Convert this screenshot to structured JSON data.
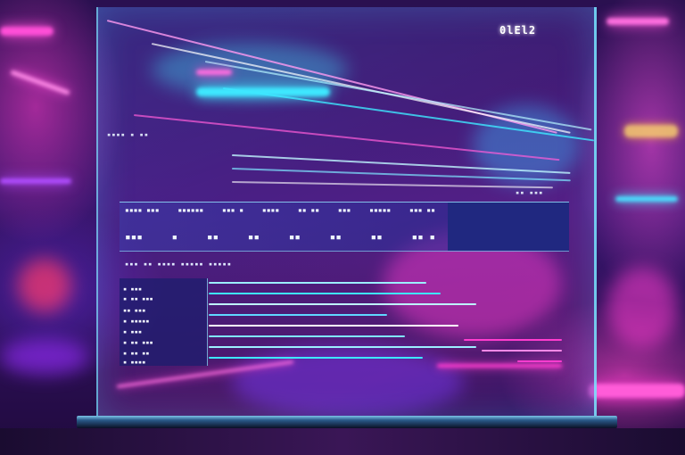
{
  "screen": {
    "header_tag": "0lEl2",
    "top_label": "▪▪▪▪ ▪ ▪▪",
    "top_right_label": "▪▪ ▪▪▪"
  },
  "table": {
    "header_cells": [
      "▪▪▪▪ ▪▪▪",
      "▪▪▪▪▪▪",
      "▪▪▪ ▪",
      "▪▪▪▪",
      "▪▪ ▪▪",
      "▪▪▪",
      "▪▪▪▪▪",
      "▪▪▪ ▪▪"
    ],
    "row_cells": [
      "▪▪▪",
      "▪",
      "▪▪",
      "▪▪",
      "▪▪",
      "▪▪",
      "▪▪",
      "▪▪ ▪"
    ]
  },
  "list": {
    "title": "▪▪▪ ▪▪ ▪▪▪▪ ▪▪▪▪▪ ▪▪▪▪▪",
    "items": [
      "▪ ▪▪▪",
      "▪ ▪▪ ▪▪▪",
      "▪▪ ▪▪▪",
      "▪ ▪▪▪▪▪",
      "▪ ▪▪▪",
      "▪ ▪▪ ▪▪▪",
      "▪ ▪▪ ▪▪",
      "▪ ▪▪▪▪"
    ]
  },
  "colors": {
    "neon_pink": "#ff3ccf",
    "neon_cyan": "#3ee8ff",
    "neon_violet": "#7a3cff",
    "panel_blue": "#202880"
  }
}
